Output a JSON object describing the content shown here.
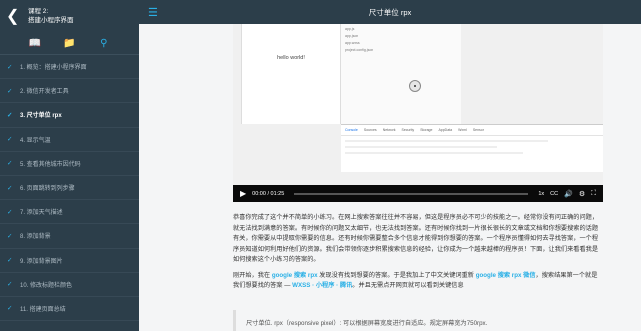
{
  "course": {
    "title_line1": "课程 2:",
    "title_line2": "搭建小程序界面"
  },
  "page_title": "尺寸单位 rpx",
  "lessons": [
    {
      "label": "1. 概览：搭建小程序界面",
      "current": false
    },
    {
      "label": "2. 微信开发者工具",
      "current": false
    },
    {
      "label": "3. 尺寸单位 rpx",
      "current": true
    },
    {
      "label": "4. 显示气温",
      "current": false
    },
    {
      "label": "5. 查看其他城市因代码",
      "current": false
    },
    {
      "label": "6. 页面跳转到列步骤",
      "current": false
    },
    {
      "label": "7. 添加天气描述",
      "current": false
    },
    {
      "label": "8. 添加背景",
      "current": false
    },
    {
      "label": "9. 添加背景图片",
      "current": false
    },
    {
      "label": "10. 修改标题栏颜色",
      "current": false
    },
    {
      "label": "11. 搭建页面总结",
      "current": false
    }
  ],
  "video": {
    "hello_text": "hello world!",
    "files": [
      "app.js",
      "app.json",
      "app.wxss",
      "project.config.json"
    ],
    "devtools_tabs": [
      "Console",
      "Sources",
      "Network",
      "Security",
      "Storage",
      "AppData",
      "Wxml",
      "Sensor"
    ],
    "time": "00:00 / 01:25",
    "speed": "1x",
    "cc": "CC",
    "progress": 0.0
  },
  "body": {
    "para1": "恭喜你完成了这个并不简单的小练习。在网上搜索答案往往并不容易，但这是程序员必不可少的技能之一。经常你没有问正确的问题，就无法找到满意的答案。有时候你的问题又太细节，也无法找到答案。还有时候你找到一片很长很长的文章或文档和你想要搜索的话题有关，你需要从中提取你需要的信息。还有时候你需要整合多个信息才能得到你想要的答案。一个程序员懂得如何去寻找答案，一个程序员知道如何利用好他们的资源。我们会带领你逐步积累搜索信息的经验，让你成为一个越来越棒的程序员！下面，让我们来看看我是如何搜索这个小练习的答案的。",
    "para2_a": "刚开始，我在 ",
    "para2_kw1": "google 搜索 rpx",
    "para2_b": " 发现没有找到想要的答案。于是我加上了中文关键词重新 ",
    "para2_kw2": "google 搜索 rpx 微信",
    "para2_c": "，搜索结果第一个就是我们想要找的答案 — ",
    "para2_kw3": "WXSS · 小程序 · 腾讯",
    "para2_d": "。并且无需点开网页就可以看到关键信息",
    "quote": "尺寸单位. rpx（responsive pixel）: 可以根据屏幕宽度进行自适应。规定屏幕宽为750rpx."
  }
}
